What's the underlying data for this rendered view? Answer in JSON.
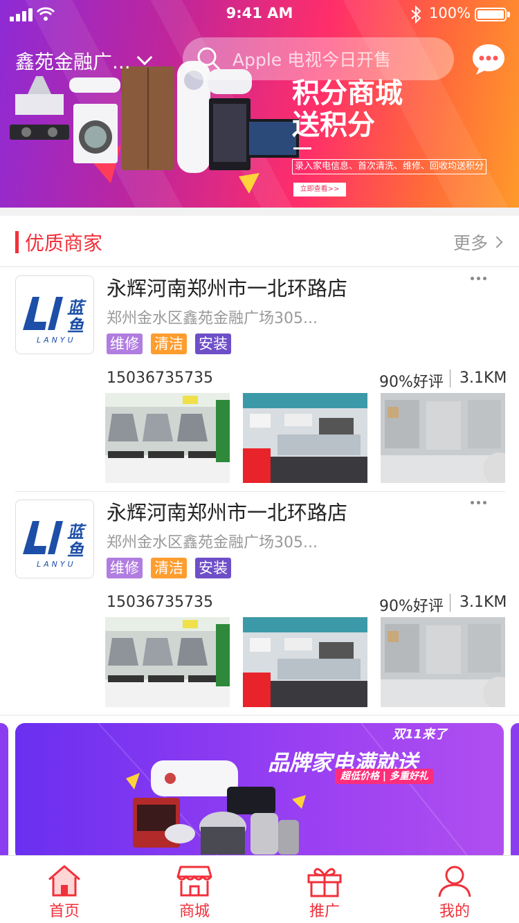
{
  "status_bar": {
    "time": "9:41 AM",
    "battery": "100%"
  },
  "header": {
    "location": "鑫苑金融广...",
    "search_placeholder": "Apple 电视今日开售"
  },
  "hero_banner": {
    "title_line1": "积分商城",
    "title_line2": "送积分",
    "subtitle": "录入家电信息、首次清洗、维修、回收均送积分",
    "cta": "立即查看>>"
  },
  "section": {
    "title": "优质商家",
    "more": "更多"
  },
  "merchants": [
    {
      "logo_text": "蓝鱼",
      "logo_sub": "LANYU",
      "name": "永辉河南郑州市一北环路店",
      "address": "郑州金水区鑫苑金融广场305...",
      "tags": [
        "维修",
        "清洁",
        "安装"
      ],
      "phone": "15036735735",
      "rating": "90%好评",
      "distance": "3.1KM"
    },
    {
      "logo_text": "蓝鱼",
      "logo_sub": "LANYU",
      "name": "永辉河南郑州市一北环路店",
      "address": "郑州金水区鑫苑金融广场305...",
      "tags": [
        "维修",
        "清洁",
        "安装"
      ],
      "phone": "15036735735",
      "rating": "90%好评",
      "distance": "3.1KM"
    }
  ],
  "promo": {
    "kicker": "双11来了",
    "headline": "品牌家电满就送",
    "pill": "超低价格 | 多重好礼"
  },
  "tabbar": [
    {
      "label": "首页",
      "icon": "home-icon"
    },
    {
      "label": "商城",
      "icon": "store-icon"
    },
    {
      "label": "推广",
      "icon": "gift-icon"
    },
    {
      "label": "我的",
      "icon": "user-icon"
    }
  ],
  "colors": {
    "accent": "#f0303a",
    "tag_repair": "#b07de0",
    "tag_clean": "#ff9d2e",
    "tag_install": "#6e4fc7",
    "logo_blue": "#1d4fa8"
  }
}
